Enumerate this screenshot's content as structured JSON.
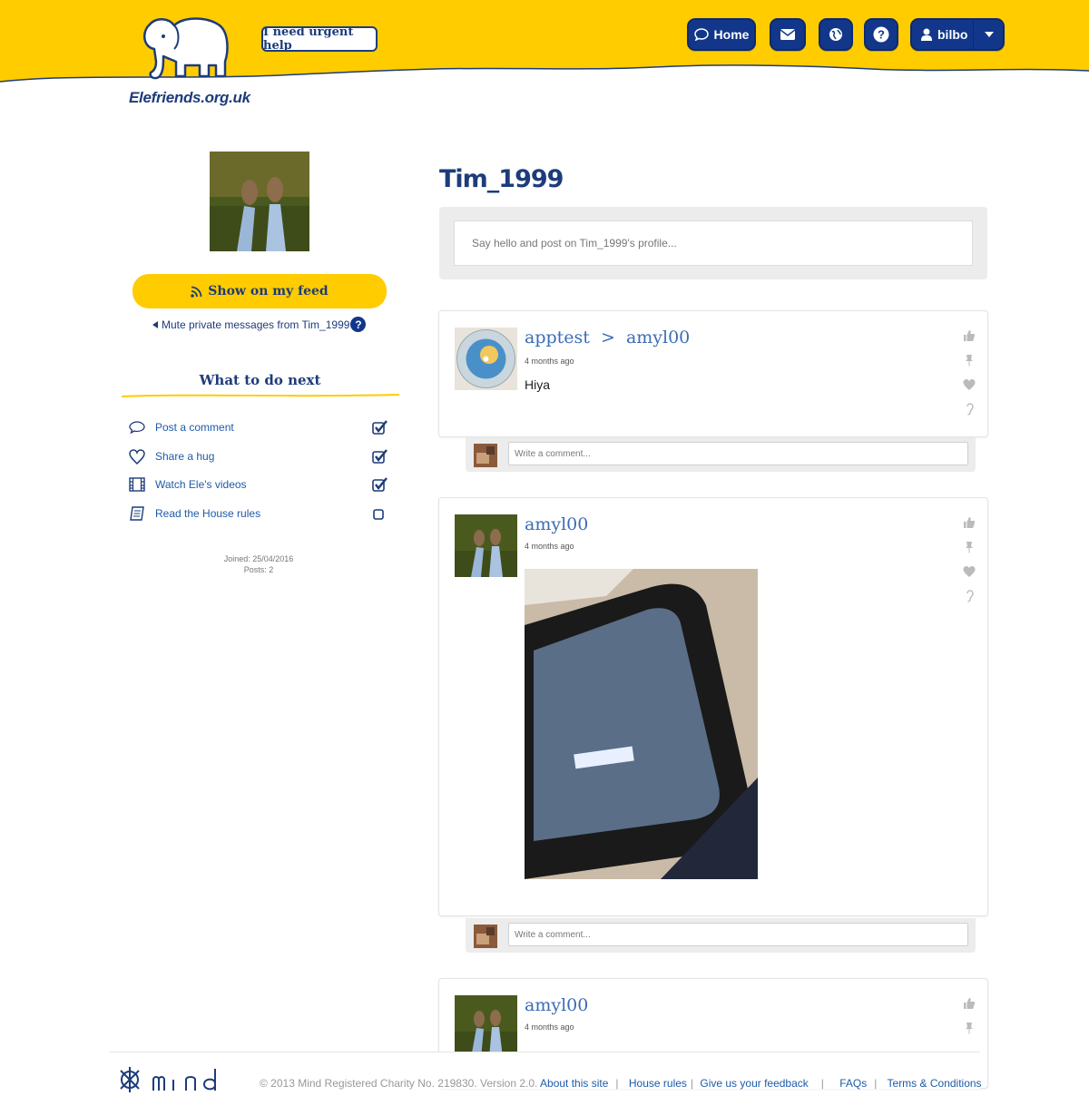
{
  "header": {
    "site_name": "Elefriends.org.uk",
    "urgent_label": "I need urgent help",
    "nav": {
      "home_label": "Home",
      "user_label": "bilbo"
    },
    "band_color": "#ffcc00"
  },
  "sidebar": {
    "feed_button": "Show on my feed",
    "mute_link": "Mute private messages from Tim_1999",
    "help_glyph": "?",
    "next_title": "What to do next",
    "todos": [
      {
        "label": "Post a comment",
        "icon": "speech-bubble-icon",
        "checked": true
      },
      {
        "label": "Share a hug",
        "icon": "heart-icon",
        "checked": true
      },
      {
        "label": "Watch Ele's videos",
        "icon": "film-icon",
        "checked": true
      },
      {
        "label": "Read the House rules",
        "icon": "book-icon",
        "checked": false
      }
    ],
    "joined": "Joined: 25/04/2016",
    "posts": "Posts: 2"
  },
  "main": {
    "profile_name": "Tim_1999",
    "post_placeholder": "Say hello and post on Tim_1999's profile...",
    "posts": [
      {
        "from": "apptest",
        "arrow": ">",
        "to": "amyl00",
        "ago": "4 months ago",
        "text": "Hiya"
      },
      {
        "from": "amyl00",
        "ago": "4 months ago",
        "text": ""
      },
      {
        "from": "amyl00",
        "ago": "4 months ago",
        "text": ""
      }
    ],
    "comment_placeholder": "Write a comment..."
  },
  "footer": {
    "copyright": "© 2013 Mind Registered Charity No. 219830. Version 2.0.",
    "links": [
      "About this site",
      "House rules",
      "Give us your feedback",
      "FAQs",
      "Terms & Conditions"
    ]
  }
}
